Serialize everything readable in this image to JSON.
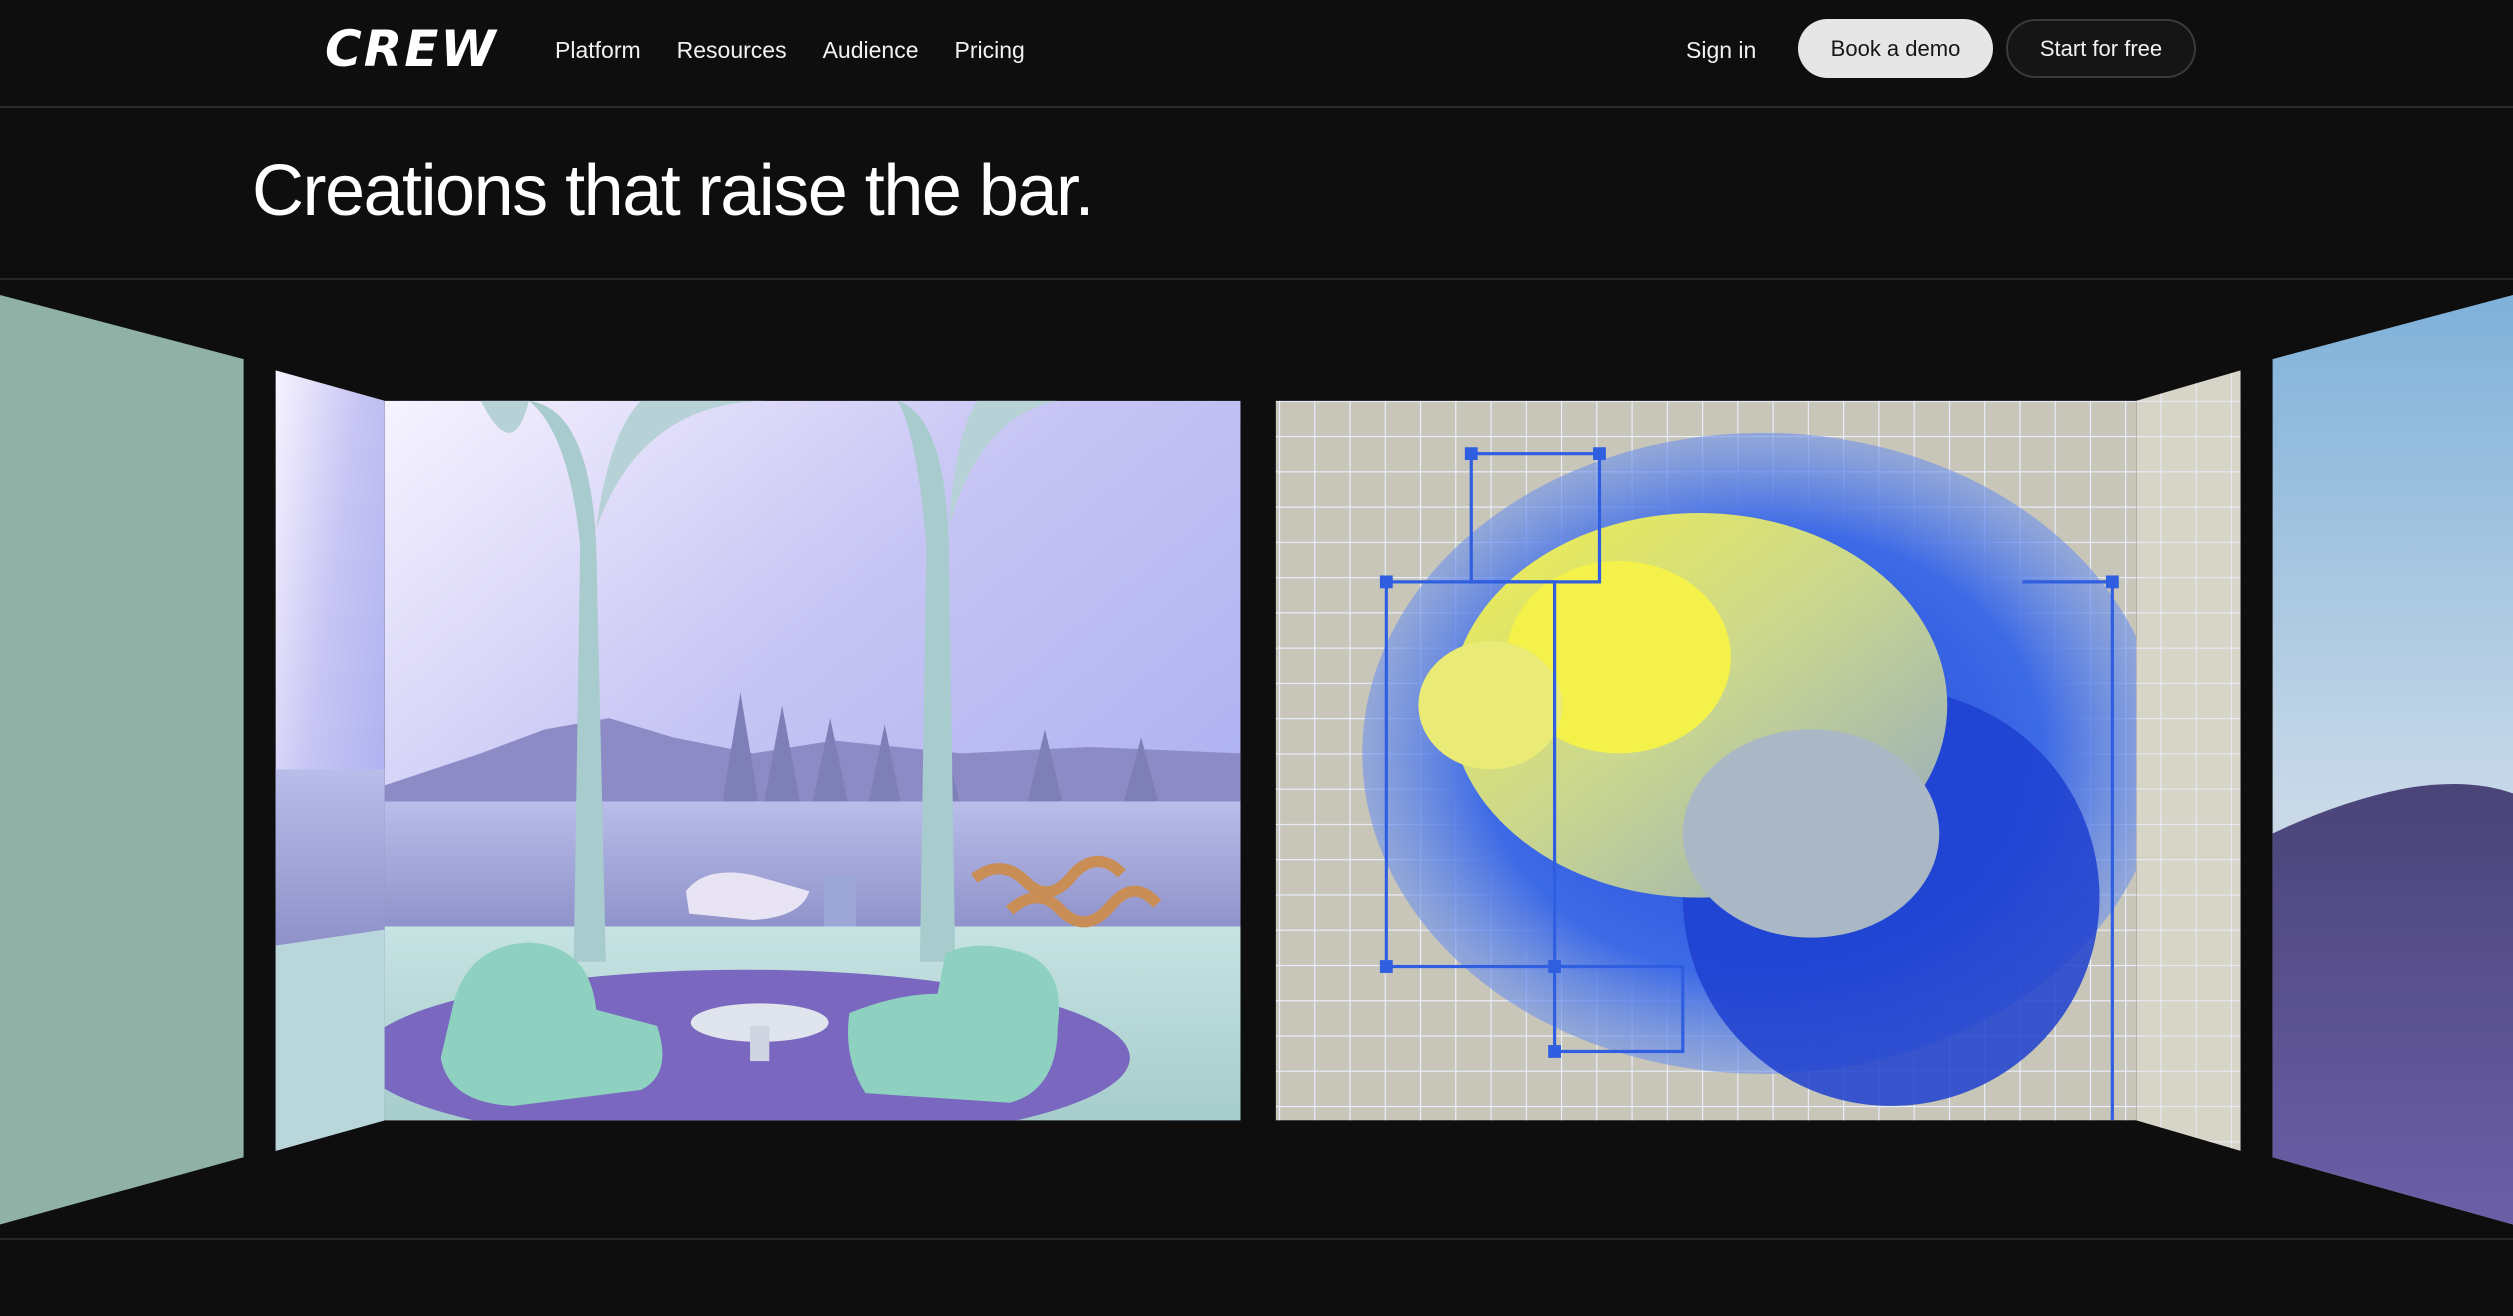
{
  "brand": {
    "logo_text": "CREW"
  },
  "nav": {
    "links": [
      {
        "label": "Platform"
      },
      {
        "label": "Resources"
      },
      {
        "label": "Audience"
      },
      {
        "label": "Pricing"
      }
    ],
    "sign_in": "Sign in",
    "book_demo": "Book a demo",
    "start_free": "Start for free"
  },
  "hero": {
    "title": "Creations that raise the bar."
  },
  "gallery": {
    "panels": [
      {
        "name": "teal-panel",
        "description_icon": "image"
      },
      {
        "name": "lake-pavilion-render",
        "description_icon": "image"
      },
      {
        "name": "coral-scan-render",
        "description_icon": "image"
      },
      {
        "name": "grid-panel",
        "description_icon": "image"
      },
      {
        "name": "meadow-sky-panel",
        "description_icon": "image"
      }
    ]
  },
  "colors": {
    "background": "#0e0e0e",
    "accent_button": "#e6e6e6",
    "grid_blue": "#2f5fe0"
  }
}
